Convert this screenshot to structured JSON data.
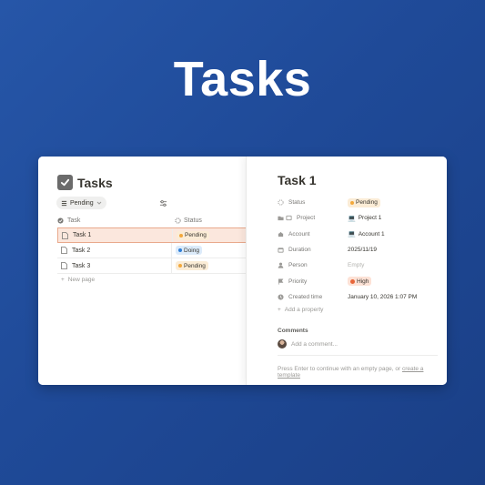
{
  "hero": {
    "title": "Tasks"
  },
  "database": {
    "title": "Tasks",
    "filter_label": "Pending",
    "columns": [
      "Task",
      "Status"
    ],
    "rows": [
      {
        "name": "Task 1",
        "status": "Pending",
        "status_color": "#f3a83b",
        "tag_bg": "#fbecd6",
        "selected": true
      },
      {
        "name": "Task 2",
        "status": "Doing",
        "status_color": "#2f7fd8",
        "tag_bg": "#dcebfa",
        "selected": false
      },
      {
        "name": "Task 3",
        "status": "Pending",
        "status_color": "#f3a83b",
        "tag_bg": "#fbecd6",
        "selected": false
      }
    ],
    "new_page_label": "New page"
  },
  "page": {
    "title": "Task 1",
    "properties": [
      {
        "name": "Status",
        "value": "Pending",
        "type": "status",
        "icon": "status-icon"
      },
      {
        "name": "Project",
        "value": "Project 1",
        "type": "relation",
        "icon": "project-icon"
      },
      {
        "name": "Account",
        "value": "Account 1",
        "type": "relation",
        "icon": "account-icon"
      },
      {
        "name": "Duration",
        "value": "2025/11/19",
        "type": "text",
        "icon": "calendar-icon"
      },
      {
        "name": "Person",
        "value": "Empty",
        "type": "empty",
        "icon": "person-icon"
      },
      {
        "name": "Priority",
        "value": "High",
        "type": "priority",
        "icon": "flag-icon"
      },
      {
        "name": "Created time",
        "value": "January 10, 2026 1:07 PM",
        "type": "text",
        "icon": "clock-icon"
      }
    ],
    "add_property_label": "Add a property",
    "comments_label": "Comments",
    "comment_placeholder": "Add a comment...",
    "footer_text": "Press Enter to continue with an empty page, or ",
    "footer_link": "create a template"
  },
  "colors": {
    "background_start": "#2656a8",
    "pending_dot": "#f3a83b",
    "doing_dot": "#2f7fd8",
    "high_bg": "#fde2d6",
    "high_icon": "#e8663a"
  }
}
